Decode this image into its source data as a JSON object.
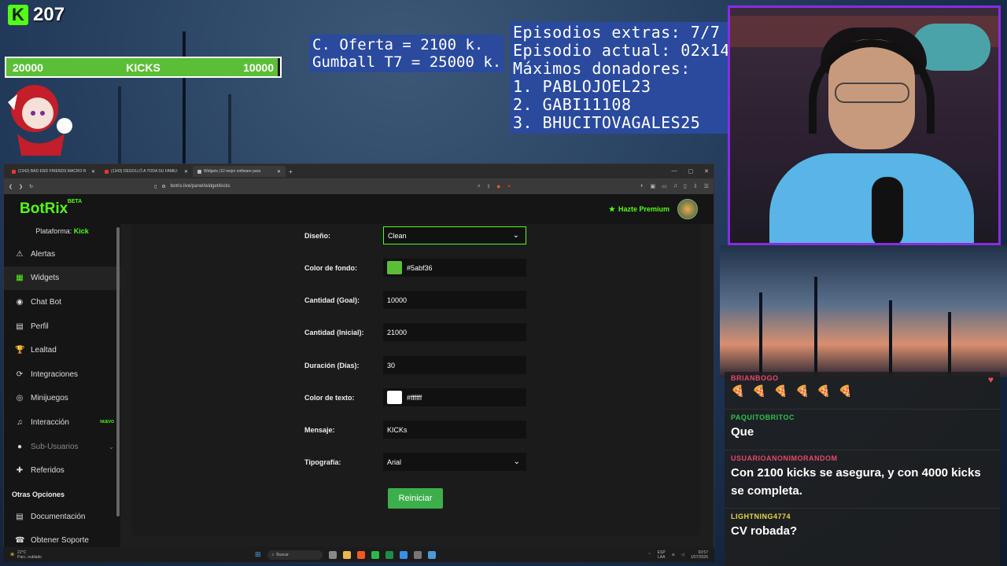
{
  "overlay": {
    "kick_count": "207",
    "goal_left": "20000",
    "goal_label": "KICKS",
    "goal_right": "10000",
    "goal_progress": 0.99,
    "offer_lines": [
      "C. Oferta = 2100 k.",
      "Gumball T7 = 25000 k."
    ],
    "episode_lines": [
      "Episodios extras: 7/7",
      "Episodio actual: 02x14",
      "Máximos donadores:",
      "1. PABLOJOEL23",
      "2. GABI11108",
      "3. BHUCITOVAGALES25"
    ]
  },
  "browser": {
    "tabs": [
      {
        "title": "(1342) BAD END FRIENDS MACRO R"
      },
      {
        "title": "(1343) DEGOLLÓ A TODA SU FAMILI"
      },
      {
        "title": "Widgets | El mejor software para"
      }
    ],
    "url": "botrix.live/panel/widget/kicks"
  },
  "app": {
    "brand": "BotRix",
    "beta": "BETA",
    "premium": "Hazte Premium",
    "platform_label": "Plataforma:",
    "platform_value": "Kick",
    "sidebar": [
      {
        "label": "Alertas",
        "icon": "⚠"
      },
      {
        "label": "Widgets",
        "icon": "▦"
      },
      {
        "label": "Chat Bot",
        "icon": "◉"
      },
      {
        "label": "Perfil",
        "icon": "▤"
      },
      {
        "label": "Lealtad",
        "icon": "🏆"
      },
      {
        "label": "Integraciones",
        "icon": "⟳"
      },
      {
        "label": "Minijuegos",
        "icon": "◎"
      },
      {
        "label": "Interacción",
        "icon": "♫",
        "badge": "NUEVO"
      },
      {
        "label": "Sub-Usuarios",
        "icon": "●"
      },
      {
        "label": "Referidos",
        "icon": "✚"
      }
    ],
    "section_title": "Otras Opciones",
    "extra_items": [
      {
        "label": "Documentación",
        "icon": "▤"
      },
      {
        "label": "Obtener Soporte",
        "icon": "☎"
      }
    ],
    "form": {
      "design_label": "Diseño:",
      "design_value": "Clean",
      "bg_color_label": "Color de fondo:",
      "bg_color_value": "#5abf36",
      "goal_label": "Cantidad (Goal):",
      "goal_value": "10000",
      "initial_label": "Cantidad (Inicial):",
      "initial_value": "21000",
      "duration_label": "Duración (Días):",
      "duration_value": "30",
      "text_color_label": "Color de texto:",
      "text_color_value": "#ffffff",
      "message_label": "Mensaje:",
      "message_value": "KICKs",
      "font_label": "Tipografía:",
      "font_value": "Arial",
      "reset_label": "Reiniciar"
    }
  },
  "chat": {
    "messages": [
      {
        "user": "BRIANBOGO",
        "user_color": "#e8486a",
        "text": "🍕 🍕 🍕 🍕 🍕 🍕"
      },
      {
        "user": "PAQUITOBRITOC",
        "user_color": "#2fc24a",
        "text": "Que"
      },
      {
        "user": "USUARIOANONIMORANDOM",
        "user_color": "#e8486a",
        "text": "Con 2100 kicks se asegura, y con 4000 kicks se completa."
      },
      {
        "user": "LIGHTNING4774",
        "user_color": "#e8d84a",
        "text": "CV robada?"
      }
    ]
  },
  "taskbar": {
    "weather_temp": "22°C",
    "weather_desc": "Parc. nublado",
    "search": "Buscar",
    "lang": "ESP",
    "lang2": "LAA",
    "time": "03:57",
    "date": "1/07/2026"
  }
}
